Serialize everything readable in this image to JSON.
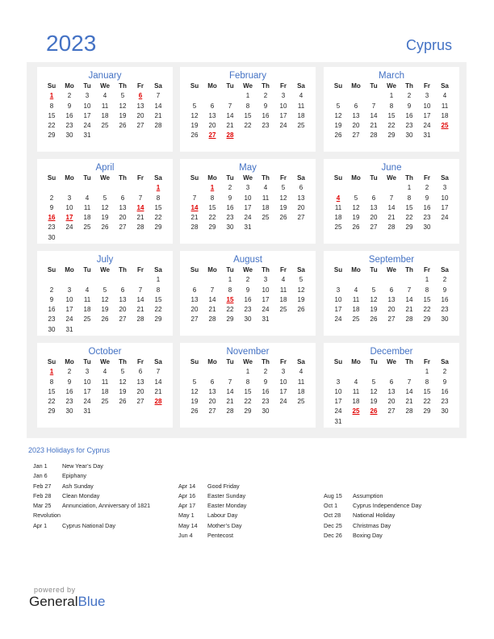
{
  "header": {
    "year": "2023",
    "country": "Cyprus"
  },
  "weekdays": [
    "Su",
    "Mo",
    "Tu",
    "We",
    "Th",
    "Fr",
    "Sa"
  ],
  "months": [
    {
      "name": "January",
      "start": 0,
      "days": 31,
      "holidays": [
        1,
        6
      ]
    },
    {
      "name": "February",
      "start": 3,
      "days": 28,
      "holidays": [
        27,
        28
      ]
    },
    {
      "name": "March",
      "start": 3,
      "days": 31,
      "holidays": [
        25
      ]
    },
    {
      "name": "April",
      "start": 6,
      "days": 30,
      "holidays": [
        1,
        14,
        16,
        17
      ]
    },
    {
      "name": "May",
      "start": 1,
      "days": 31,
      "holidays": [
        1,
        14
      ]
    },
    {
      "name": "June",
      "start": 4,
      "days": 30,
      "holidays": [
        4
      ]
    },
    {
      "name": "July",
      "start": 6,
      "days": 31,
      "holidays": []
    },
    {
      "name": "August",
      "start": 2,
      "days": 31,
      "holidays": [
        15
      ]
    },
    {
      "name": "September",
      "start": 5,
      "days": 30,
      "holidays": []
    },
    {
      "name": "October",
      "start": 0,
      "days": 31,
      "holidays": [
        1,
        28
      ]
    },
    {
      "name": "November",
      "start": 3,
      "days": 30,
      "holidays": []
    },
    {
      "name": "December",
      "start": 5,
      "days": 31,
      "holidays": [
        25,
        26
      ]
    }
  ],
  "holidays_title": "2023 Holidays for Cyprus",
  "holiday_columns": [
    [
      {
        "date": "Jan 1",
        "name": "New Year’s Day"
      },
      {
        "date": "Jan 6",
        "name": "Epiphany"
      },
      {
        "date": "Feb 27",
        "name": "Ash Sunday"
      },
      {
        "date": "Feb 28",
        "name": "Clean Monday"
      },
      {
        "date": "Mar 25",
        "name": "Annunciation, Anniversary of 1821"
      },
      {
        "date": "",
        "name": "Revolution",
        "wrap": true
      },
      {
        "date": "Apr 1",
        "name": "Cyprus National Day"
      }
    ],
    [
      {
        "date": "",
        "name": ""
      },
      {
        "date": "",
        "name": ""
      },
      {
        "date": "Apr 14",
        "name": "Good Friday"
      },
      {
        "date": "Apr 16",
        "name": "Easter Sunday"
      },
      {
        "date": "Apr 17",
        "name": "Easter Monday"
      },
      {
        "date": "May 1",
        "name": "Labour Day"
      },
      {
        "date": "May 14",
        "name": "Mother’s Day"
      },
      {
        "date": "Jun 4",
        "name": "Pentecost"
      }
    ],
    [
      {
        "date": "",
        "name": ""
      },
      {
        "date": "",
        "name": ""
      },
      {
        "date": "",
        "name": ""
      },
      {
        "date": "Aug 15",
        "name": "Assumption"
      },
      {
        "date": "Oct 1",
        "name": "Cyprus Independence Day"
      },
      {
        "date": "Oct 28",
        "name": "National Holiday"
      },
      {
        "date": "Dec 25",
        "name": "Christmas Day"
      },
      {
        "date": "Dec 26",
        "name": "Boxing Day"
      }
    ]
  ],
  "footer": {
    "powered_by": "powered by",
    "brand_general": "General",
    "brand_blue": "Blue"
  }
}
